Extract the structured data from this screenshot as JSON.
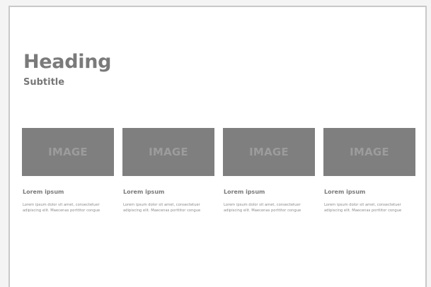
{
  "header": {
    "heading": "Heading",
    "subtitle": "Subtitle"
  },
  "cards": [
    {
      "image_label": "IMAGE",
      "title": "Lorem ipsum",
      "text": "Lorem ipsum dolor sit amet, consectetuer adipiscing elit. Maecenas porttitor congue"
    },
    {
      "image_label": "IMAGE",
      "title": "Lorem ipsum",
      "text": "Lorem ipsum dolor sit amet, consectetuer adipiscing elit. Maecenas porttitor congue"
    },
    {
      "image_label": "IMAGE",
      "title": "Lorem ipsum",
      "text": "Lorem ipsum dolor sit amet, consectetuer adipiscing elit. Maecenas porttitor congue"
    },
    {
      "image_label": "IMAGE",
      "title": "Lorem ipsum",
      "text": "Lorem ipsum dolor sit amet, consectetuer adipiscing elit. Maecenas porttitor congue"
    }
  ],
  "colors": {
    "placeholder_fill": "#7f7f7f",
    "placeholder_text": "#9c9c9c",
    "heading_text": "#7a7a7a",
    "frame_border": "#c9c9c9"
  }
}
